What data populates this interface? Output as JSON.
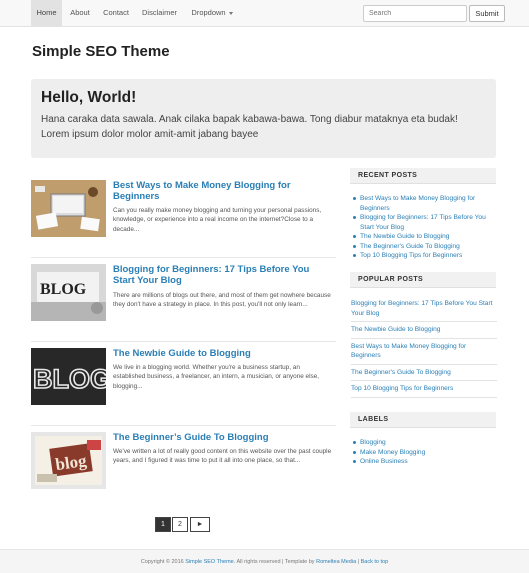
{
  "nav": {
    "items": [
      {
        "label": "Home"
      },
      {
        "label": "About"
      },
      {
        "label": "Contact"
      },
      {
        "label": "Disclaimer"
      },
      {
        "label": "Dropdown"
      }
    ],
    "search_placeholder": "Search",
    "submit_label": "Submit"
  },
  "site_title": "Simple SEO Theme",
  "jumbotron": {
    "title": "Hello, World!",
    "text": "Hana caraka data sawala. Anak cilaka bapak kabawa-bawa. Tong diabur mataknya eta budak! Lorem ipsum dolor molor amit-amit jabang bayee"
  },
  "posts": [
    {
      "title": "Best Ways to Make Money Blogging for Beginners",
      "excerpt": "Can you really make money blogging and turning your personal passions, knowledge, or experience into a real income on the internet?Close to a decade..."
    },
    {
      "title": "Blogging for Beginners: 17 Tips Before You Start Your Blog",
      "excerpt": "There are millions of blogs out there, and most of them get nowhere because they don't have a strategy in place. In this post, you'll not only learn..."
    },
    {
      "title": "The Newbie Guide to Blogging",
      "excerpt": "We live in a blogging world. Whether you're a business startup, an established business, a freelancer, an intern, a musician, or anyone else, blogging..."
    },
    {
      "title": "The Beginner’s Guide To Blogging",
      "excerpt": "We've written a lot of really good content on this website over the past couple years, and I figured it was time to put it all into one place, so that..."
    }
  ],
  "sidebar": {
    "recent_title": "RECENT POSTS",
    "recent_posts": [
      "Best Ways to Make Money Blogging for Beginners",
      "Blogging for Beginners: 17 Tips Before You Start Your Blog",
      "The Newbie Guide to Blogging",
      "The Beginner's Guide To Blogging",
      "Top 10 Blogging Tips for Beginners"
    ],
    "popular_title": "POPULAR POSTS",
    "popular_posts": [
      "Blogging for Beginners: 17 Tips Before You Start Your Blog",
      "The Newbie Guide to Blogging",
      "Best Ways to Make Money Blogging for Beginners",
      "The Beginner's Guide To Blogging",
      "Top 10 Blogging Tips for Beginners"
    ],
    "labels_title": "LABELS",
    "labels": [
      "Blogging",
      "Make Money Blogging",
      "Online Business"
    ]
  },
  "pagination": {
    "pages": [
      "1",
      "2"
    ],
    "next": "►"
  },
  "footer": {
    "copyright": "Copyright © 2016",
    "site_link": "Simple SEO Theme",
    "rights": ". All rights reserved | Template by",
    "author_link": "Romeltea Media",
    "sep": "|",
    "top_link": "Back to top"
  },
  "colors": {
    "link": "#2a7fb5",
    "jumbotron_bg": "#eeeeee",
    "navbar_bg": "#f8f8f8"
  }
}
